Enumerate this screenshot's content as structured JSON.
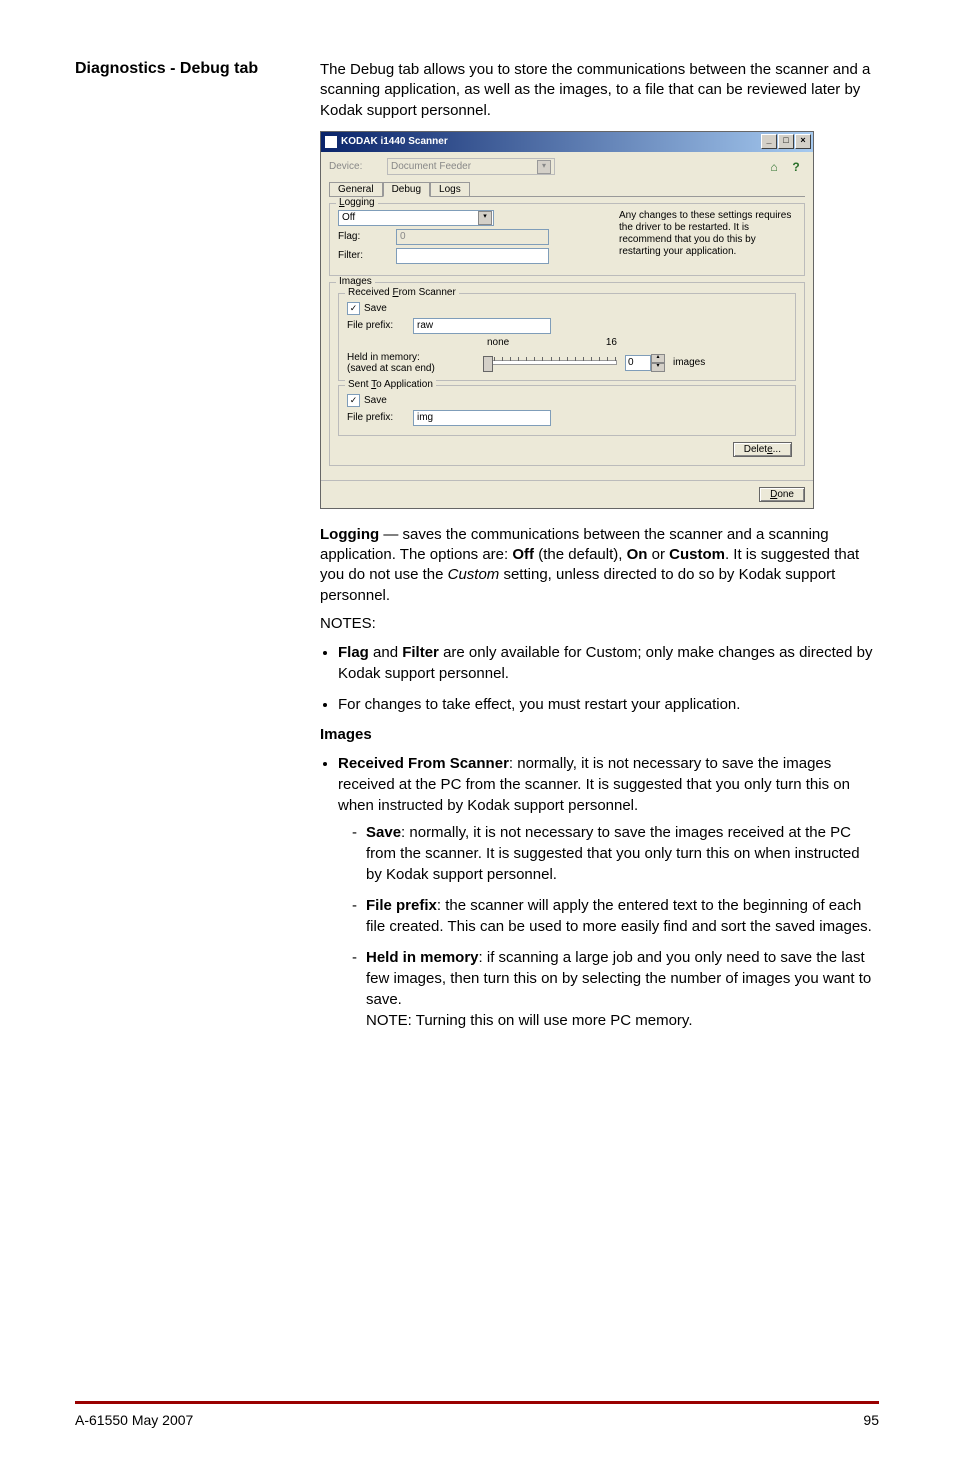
{
  "section_heading": "Diagnostics - Debug tab",
  "intro": "The Debug tab allows you to store the communications between the scanner and a scanning application, as well as the images, to a file that can be reviewed later by Kodak support personnel.",
  "window": {
    "title": "KODAK i1440 Scanner",
    "device_label": "Device:",
    "device_value": "Document Feeder",
    "tabs": {
      "general": "General",
      "debug": "Debug",
      "logs": "Logs"
    },
    "logging": {
      "group_title": "Logging",
      "selected": "Off",
      "flag_label": "Flag:",
      "flag_value": "0",
      "filter_label": "Filter:",
      "filter_value": "",
      "note": "Any changes to these settings requires the driver to be restarted. It is recommend that you do this by restarting your application."
    },
    "images": {
      "group_title": "Images",
      "received": {
        "title": "Received From Scanner",
        "save_label": "Save",
        "save_checked": true,
        "prefix_label": "File prefix:",
        "prefix_value": "raw",
        "slider_label_left": "none",
        "slider_label_right": "16",
        "held_label1": "Held in memory:",
        "held_label2": "(saved at scan end)",
        "spinner_value": "0",
        "spinner_suffix": "images"
      },
      "sent": {
        "title": "Sent To Application",
        "save_label": "Save",
        "save_checked": true,
        "prefix_label": "File prefix:",
        "prefix_value": "img"
      },
      "delete_btn": "Delete..."
    },
    "done_btn": "Done"
  },
  "body": {
    "logging_heading": "Logging",
    "logging_text_1": " — saves the communications between the scanner and a scanning application. The options are: ",
    "logging_off": "Off",
    "logging_default": " (the default), ",
    "logging_on": "On",
    "logging_or": " or ",
    "logging_custom": "Custom",
    "logging_text_2": ". It is suggested that you do not use the ",
    "logging_custom_italic": "Custom",
    "logging_text_3": " setting, unless directed to do so by Kodak support personnel.",
    "notes_label": "NOTES:",
    "note1_a": "Flag",
    "note1_b": " and ",
    "note1_c": "Filter",
    "note1_d": " are only available for Custom; only make changes as directed by Kodak support personnel.",
    "note2": "For changes to take effect, you must restart your application.",
    "images_heading": "Images",
    "recv_bold": "Received From Scanner",
    "recv_text": ": normally, it is not necessary to save the images received at the PC from the scanner. It is suggested that you only turn this on when instructed by Kodak support personnel.",
    "save_bold": "Save",
    "save_text": ": normally, it is not necessary to save the images received at the PC from the scanner. It is suggested that you only turn this on on when instructed by Kodak support personnel.",
    "fp_bold": "File prefix",
    "fp_text": ": the scanner will apply the entered text to the beginning of each file created. This can be used to more easily find and sort the saved images.",
    "him_bold": "Held in memory",
    "him_text": ": if scanning a large job and you only need to save the last few images, then turn this on by selecting the number of images you want to save.",
    "him_note": "NOTE:  Turning this on will use more PC memory."
  },
  "footer": {
    "left": "A-61550  May 2007",
    "right": "95"
  }
}
